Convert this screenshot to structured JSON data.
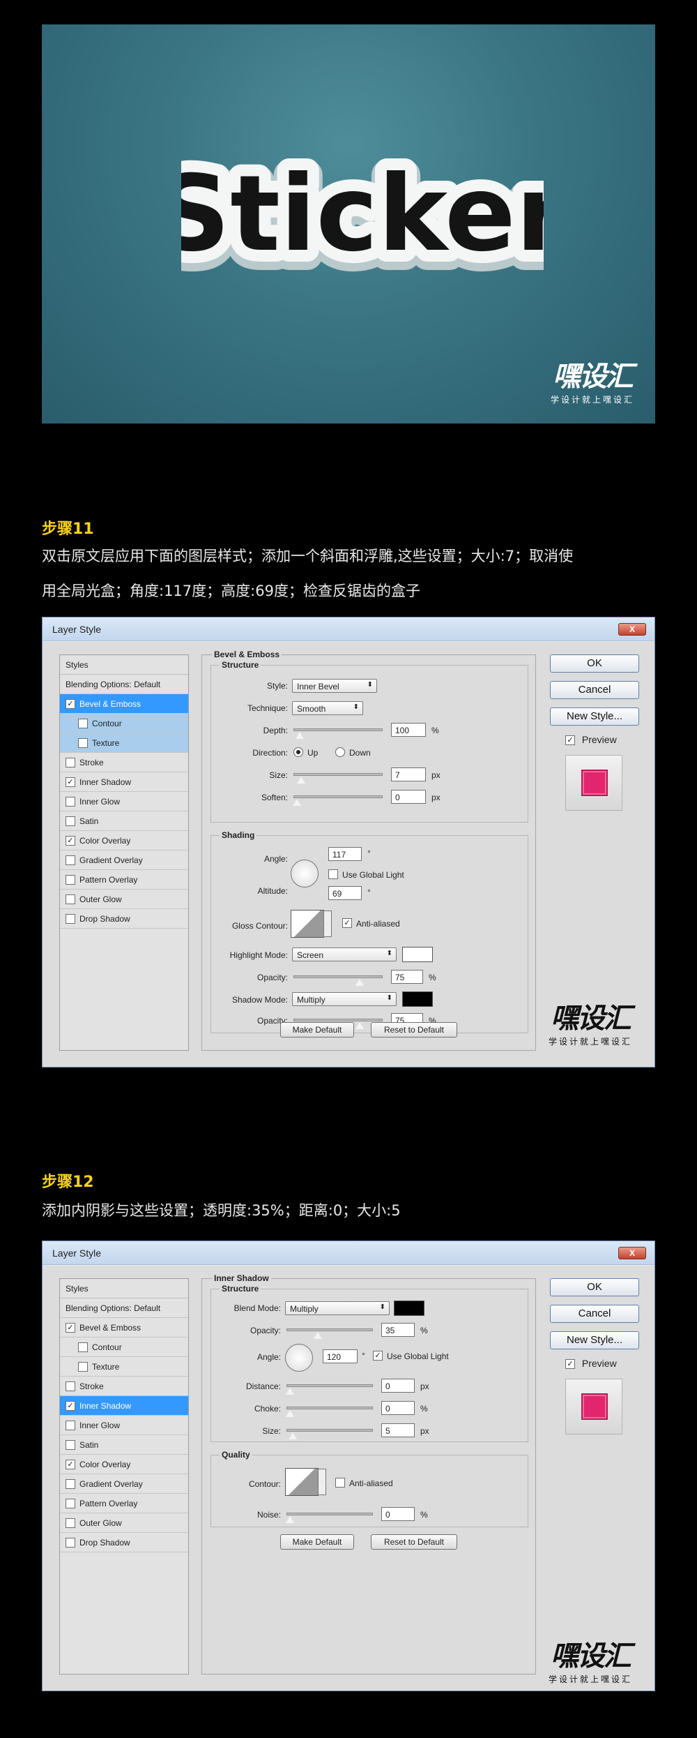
{
  "hero": {
    "sticker_text": "Sticker",
    "watermark_big": "嘿设汇",
    "watermark_small": "学设计就上嘿设汇"
  },
  "step11": {
    "title": "步骤11",
    "desc_line1": "双击原文层应用下面的图层样式；添加一个斜面和浮雕,这些设置；大小:7；取消使",
    "desc_line2": "用全局光盒；角度:117度；高度:69度；检查反锯齿的盒子"
  },
  "step12": {
    "title": "步骤12",
    "desc_line1": "添加内阴影与这些设置；透明度:35%；距离:0；大小:5"
  },
  "dialog": {
    "title": "Layer Style",
    "close": "X",
    "styles_header": "Styles",
    "blending": "Blending Options: Default",
    "ok": "OK",
    "cancel": "Cancel",
    "new_style": "New Style...",
    "preview": "Preview",
    "make_default": "Make Default",
    "reset_default": "Reset to Default",
    "check": "✓",
    "items": {
      "bevel": "Bevel & Emboss",
      "contour": "Contour",
      "texture": "Texture",
      "stroke": "Stroke",
      "inner_shadow": "Inner Shadow",
      "inner_glow": "Inner Glow",
      "satin": "Satin",
      "color_overlay": "Color Overlay",
      "gradient_overlay": "Gradient Overlay",
      "pattern_overlay": "Pattern Overlay",
      "outer_glow": "Outer Glow",
      "drop_shadow": "Drop Shadow"
    }
  },
  "bevel": {
    "panel_title": "Bevel & Emboss",
    "structure": "Structure",
    "style_label": "Style:",
    "style_value": "Inner Bevel",
    "technique_label": "Technique:",
    "technique_value": "Smooth",
    "depth_label": "Depth:",
    "depth_value": "100",
    "depth_unit": "%",
    "direction_label": "Direction:",
    "dir_up": "Up",
    "dir_down": "Down",
    "size_label": "Size:",
    "size_value": "7",
    "size_unit": "px",
    "soften_label": "Soften:",
    "soften_value": "0",
    "soften_unit": "px",
    "shading": "Shading",
    "angle_label": "Angle:",
    "angle_value": "117",
    "deg": "°",
    "use_global": "Use Global Light",
    "altitude_label": "Altitude:",
    "altitude_value": "69",
    "gloss_label": "Gloss Contour:",
    "anti_aliased": "Anti-aliased",
    "highlight_label": "Highlight Mode:",
    "highlight_value": "Screen",
    "opacity_label": "Opacity:",
    "highlight_opacity": "75",
    "pct": "%",
    "shadow_label": "Shadow Mode:",
    "shadow_value": "Multiply",
    "shadow_opacity": "75"
  },
  "inner": {
    "panel_title": "Inner Shadow",
    "structure": "Structure",
    "blend_label": "Blend Mode:",
    "blend_value": "Multiply",
    "opacity_label": "Opacity:",
    "opacity_value": "35",
    "pct": "%",
    "angle_label": "Angle:",
    "angle_value": "120",
    "deg": "°",
    "use_global": "Use Global Light",
    "distance_label": "Distance:",
    "distance_value": "0",
    "px": "px",
    "choke_label": "Choke:",
    "choke_value": "0",
    "size_label": "Size:",
    "size_value": "5",
    "quality": "Quality",
    "contour_label": "Contour:",
    "anti_aliased": "Anti-aliased",
    "noise_label": "Noise:",
    "noise_value": "0"
  },
  "colors": {
    "preview_pink": "#e2266e",
    "step_title": "#f5d21b",
    "selection": "#3399ff"
  }
}
